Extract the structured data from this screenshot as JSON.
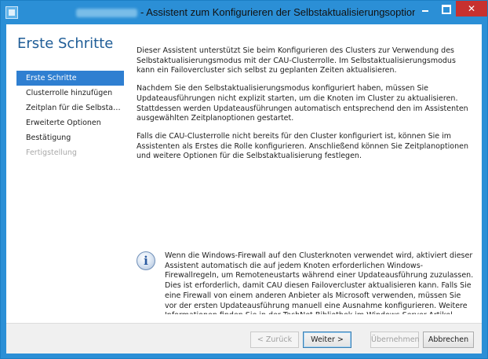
{
  "window": {
    "title": "- Assistent zum Konfigurieren der Selbstaktualisierungsoptionen",
    "colors": {
      "titlebar": "#2b8fd6",
      "close": "#c7312f",
      "accent": "#2f7fd1",
      "heading": "#1f5d97"
    }
  },
  "page": {
    "title": "Erste Schritte"
  },
  "nav": {
    "items": [
      {
        "label": "Erste Schritte",
        "state": "active"
      },
      {
        "label": "Clusterrolle hinzufügen",
        "state": "normal"
      },
      {
        "label": "Zeitplan für die Selbstakt...",
        "state": "normal"
      },
      {
        "label": "Erweiterte Optionen",
        "state": "normal"
      },
      {
        "label": "Bestätigung",
        "state": "normal"
      },
      {
        "label": "Fertigstellung",
        "state": "disabled"
      }
    ]
  },
  "content": {
    "paragraphs": [
      "Dieser Assistent unterstützt Sie beim Konfigurieren des Clusters zur Verwendung des Selbstaktualisierungsmodus mit der CAU-Clusterrolle. Im Selbstaktualisierungsmodus kann ein Failovercluster sich selbst zu geplanten Zeiten aktualisieren.",
      "Nachdem Sie den Selbstaktualisierungsmodus konfiguriert haben, müssen Sie Updateausführungen nicht explizit starten, um die Knoten im Cluster zu aktualisieren. Stattdessen werden Updateausführungen automatisch entsprechend den im Assistenten ausgewählten Zeitplanoptionen gestartet.",
      "Falls die CAU-Clusterrolle nicht bereits für den Cluster konfiguriert ist, können Sie im Assistenten als Erstes die Rolle konfigurieren. Anschließend können Sie Zeitplanoptionen und weitere Optionen für die Selbstaktualisierung festlegen."
    ]
  },
  "info": {
    "icon": "info-icon",
    "text": "Wenn die Windows-Firewall auf den Clusterknoten verwendet wird, aktiviert dieser Assistent automatisch die auf jedem Knoten erforderlichen Windows-Firewallregeln, um Remoteneustarts während einer Updateausführung zuzulassen. Dies ist erforderlich, damit CAU diesen Failovercluster aktualisieren kann. Falls Sie eine Firewall von einem anderen Anbieter als Microsoft verwenden, müssen Sie vor der ersten Updateausführung manuell eine Ausnahme konfigurieren. Weitere Informationen finden Sie in der TechNet-Bibliothek im Windows Server-Artikel „CAU-Anforderungen“."
  },
  "buttons": {
    "back": "< Zurück",
    "next": "Weiter >",
    "finish": "Übernehmen",
    "cancel": "Abbrechen"
  }
}
